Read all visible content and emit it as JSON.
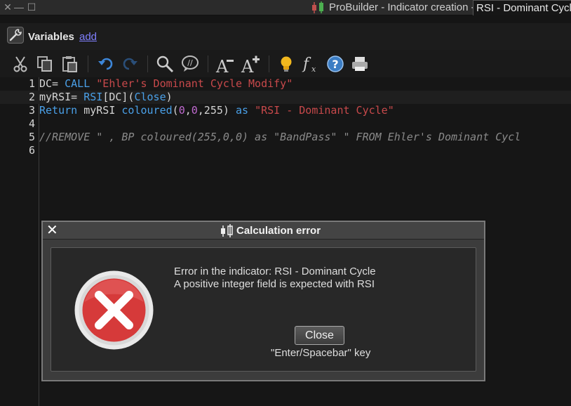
{
  "window": {
    "title": "ProBuilder - Indicator creation -",
    "tab_label": "RSI - Dominant Cycle",
    "close_glyph": "✕",
    "minimize_glyph": "—",
    "maximize_glyph": "☐"
  },
  "variables_panel": {
    "label": "Variables",
    "add_link": "add"
  },
  "toolbar": {
    "icons": [
      "cut-icon",
      "copy-icon",
      "paste-icon",
      "undo-icon",
      "redo-icon",
      "search-icon",
      "comment-icon",
      "decrease-font-icon",
      "increase-font-icon",
      "lightbulb-icon",
      "function-icon",
      "help-icon",
      "print-icon"
    ],
    "font_letter": "A",
    "function_glyph": "f",
    "function_sub": "x",
    "help_glyph": "?",
    "comment_glyph": "//"
  },
  "editor": {
    "line_numbers": [
      "1",
      "2",
      "3",
      "4",
      "5",
      "6"
    ],
    "lines": [
      {
        "tokens": [
          {
            "t": "DC= ",
            "c": "plain"
          },
          {
            "t": "CALL ",
            "c": "kw"
          },
          {
            "t": "\"Ehler's Dominant Cycle Modify\"",
            "c": "str"
          }
        ]
      },
      {
        "tokens": [
          {
            "t": "myRSI= ",
            "c": "plain"
          },
          {
            "t": "RSI",
            "c": "kw"
          },
          {
            "t": "[DC](",
            "c": "plain"
          },
          {
            "t": "Close",
            "c": "kw"
          },
          {
            "t": ")",
            "c": "plain"
          }
        ]
      },
      {
        "tokens": [
          {
            "t": "Return ",
            "c": "kw"
          },
          {
            "t": "myRSI ",
            "c": "plain"
          },
          {
            "t": "coloured",
            "c": "kw"
          },
          {
            "t": "(",
            "c": "plain"
          },
          {
            "t": "0",
            "c": "num"
          },
          {
            "t": ",",
            "c": "plain"
          },
          {
            "t": "0",
            "c": "num"
          },
          {
            "t": ",255) ",
            "c": "plain"
          },
          {
            "t": "as ",
            "c": "kw"
          },
          {
            "t": "\"RSI - Dominant Cycle\"",
            "c": "str"
          }
        ]
      },
      {
        "tokens": []
      },
      {
        "tokens": [
          {
            "t": "//REMOVE \" , BP coloured(255,0,0) as \"BandPass\" \" FROM Ehler's Dominant Cycl",
            "c": "cmt"
          }
        ]
      },
      {
        "tokens": []
      }
    ]
  },
  "dialog": {
    "close_glyph": "✕",
    "title": "Calculation error",
    "message_line1": "Error in the indicator: RSI - Dominant Cycle",
    "message_line2": "A positive integer field is expected with RSI",
    "close_button": "Close",
    "key_hint": "\"Enter/Spacebar\" key"
  },
  "colors": {
    "keyword": "#4aa0e8",
    "string": "#c8494b",
    "number": "#c06ad0",
    "comment": "#8a8a8a",
    "error_red": "#d63a3a",
    "link": "#8080ff"
  }
}
